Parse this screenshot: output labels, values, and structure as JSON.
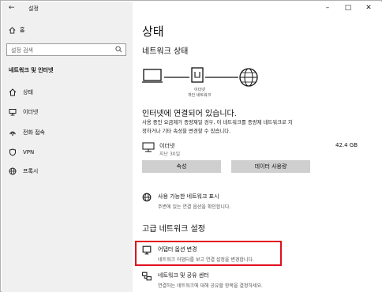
{
  "window": {
    "title": "설정",
    "back_icon": "back-arrow-icon",
    "controls": [
      "minimize-icon",
      "maximize-icon",
      "close-icon"
    ]
  },
  "sidebar": {
    "home_label": "홈",
    "search_placeholder": "설정 검색",
    "section_title": "네트워크 및 인터넷",
    "items": [
      {
        "label": "상태",
        "icon": "home-network-icon"
      },
      {
        "label": "이더넷",
        "icon": "ethernet-icon"
      },
      {
        "label": "전화 접속",
        "icon": "dialup-icon"
      },
      {
        "label": "VPN",
        "icon": "vpn-icon"
      },
      {
        "label": "프록시",
        "icon": "globe-icon"
      }
    ]
  },
  "main": {
    "page_title": "상태",
    "network_status_title": "네트워크 상태",
    "diagram": {
      "adapter_label": "이더넷",
      "network_label": "개인 네트워크"
    },
    "connected_title": "인터넷에 연결되어 있습니다.",
    "connected_desc": "사용 중인 요금제가 종량제일 경우, 이 네트워크를 종량제 네트워크로 지정하거나 기타 속성을 변경할 수 있습니다.",
    "ethernet": {
      "name": "이더넷",
      "subtitle": "지난 30일",
      "usage": "42.4 GB"
    },
    "buttons": {
      "properties": "속성",
      "data_usage": "데이터 사용량"
    },
    "show_networks": {
      "title": "사용 가능한 네트워크 표시",
      "desc": "주변에 있는 연결 옵션을 확인합니다."
    },
    "advanced_title": "고급 네트워크 설정",
    "adapter_options": {
      "title": "어댑터 옵션 변경",
      "desc": "네트워크 어댑터를 보고 연결 설정을 변경합니다."
    },
    "sharing_center": {
      "title": "네트워크 및 공유 센터",
      "desc": "연결하는 네트워크에 대해 공유할 항목을 결정하세요."
    }
  },
  "colors": {
    "highlight": "#e0101e",
    "sidebar_bg": "#f0f0f0"
  }
}
